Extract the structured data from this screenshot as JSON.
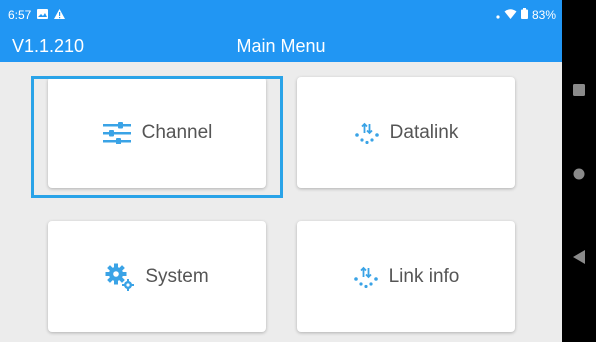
{
  "status_bar": {
    "time": "6:57",
    "left_icons": [
      "image-icon",
      "warning-icon"
    ],
    "right_icons": [
      "signal-icon",
      "wifi-icon",
      "battery-icon"
    ],
    "battery": "83%"
  },
  "app_bar": {
    "version": "V1.1.210",
    "title": "Main Menu"
  },
  "menu": {
    "items": [
      {
        "label": "Channel",
        "icon": "sliders-icon"
      },
      {
        "label": "Datalink",
        "icon": "datalink-icon"
      },
      {
        "label": "System",
        "icon": "gears-icon"
      },
      {
        "label": "Link info",
        "icon": "link-info-icon"
      }
    ],
    "focused": "Channel"
  },
  "nav_bar": {
    "buttons": [
      "recents-square-icon",
      "home-circle-icon",
      "back-triangle-icon"
    ]
  },
  "colors": {
    "accent": "#2196f3",
    "icon": "#3aa3e6",
    "focus": "#29a3e8",
    "background": "#ececec"
  }
}
